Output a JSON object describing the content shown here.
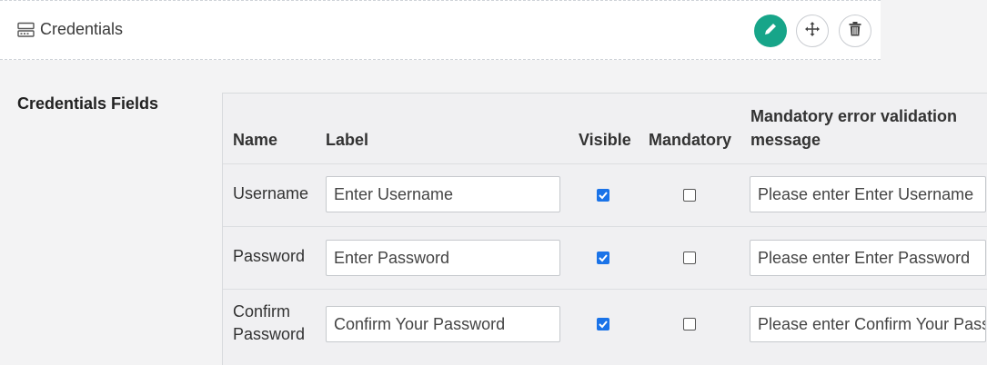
{
  "header": {
    "title": "Credentials",
    "icon": "server-icon",
    "actions": [
      {
        "name": "edit",
        "icon": "pencil-icon",
        "color": "#17a589"
      },
      {
        "name": "move",
        "icon": "move-arrows-icon"
      },
      {
        "name": "delete",
        "icon": "trash-icon"
      }
    ]
  },
  "section": {
    "label": "Credentials Fields"
  },
  "table": {
    "columns": {
      "name": "Name",
      "label": "Label",
      "visible": "Visible",
      "mandatory": "Mandatory",
      "error_line1": "Mandatory error validation",
      "error_line2": "message"
    },
    "rows": [
      {
        "name": "Username",
        "name_line2": "",
        "label": "Enter Username",
        "visible": true,
        "mandatory": false,
        "error_message": "Please enter Enter Username"
      },
      {
        "name": "Password",
        "name_line2": "",
        "label": "Enter Password",
        "visible": true,
        "mandatory": false,
        "error_message": "Please enter Enter Password"
      },
      {
        "name": "Confirm",
        "name_line2": "Password",
        "label": "Confirm Your Password",
        "visible": true,
        "mandatory": false,
        "error_message": "Please enter Confirm Your Password"
      }
    ]
  },
  "colors": {
    "accent": "#17a589",
    "checkbox": "#1a73e8"
  }
}
